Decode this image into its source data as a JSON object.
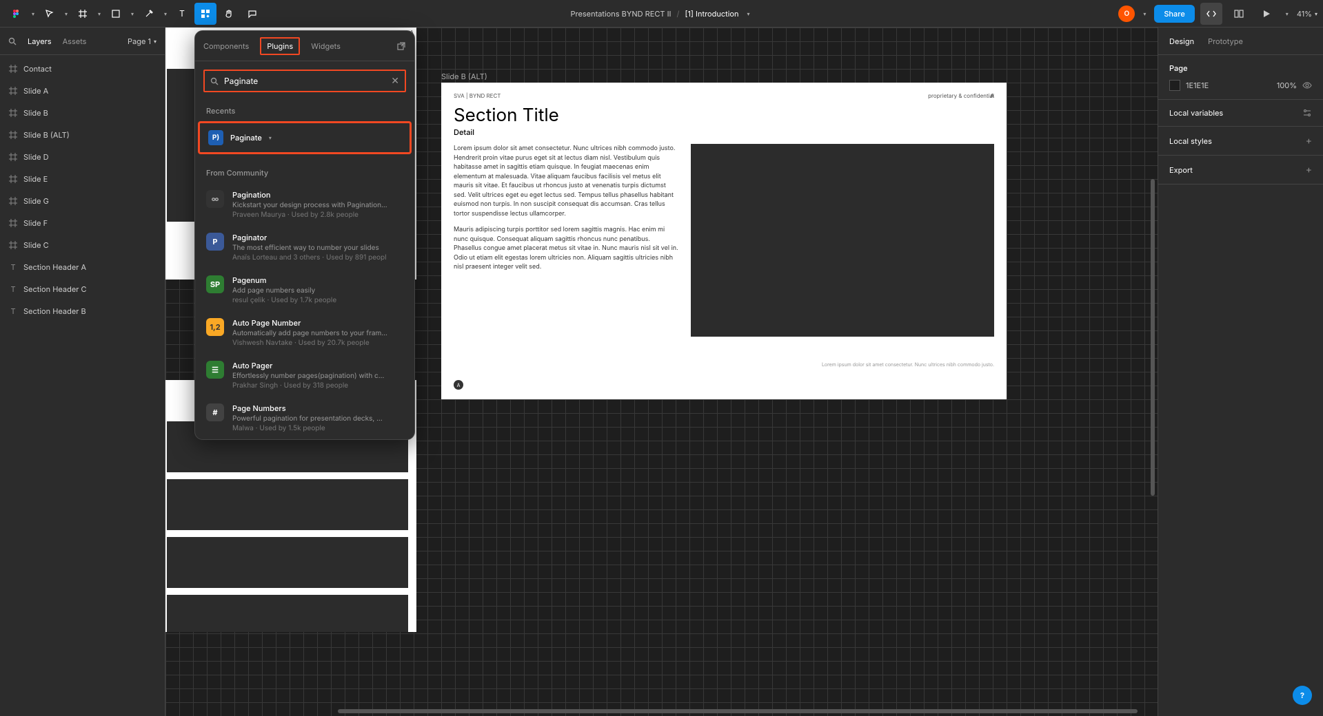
{
  "colors": {
    "accent": "#0c8ce9",
    "highlight": "#f24822",
    "bg": "#2c2c2c",
    "canvas": "#1e1e1e"
  },
  "toolbar": {
    "doc_crumb": "Presentations BYND RECT II",
    "doc_current": "[1] Introduction",
    "avatar_initial": "O",
    "share": "Share",
    "zoom": "41%"
  },
  "left": {
    "tab_layers": "Layers",
    "tab_assets": "Assets",
    "page_label": "Page 1",
    "layers": [
      {
        "icon": "frame",
        "name": "Contact"
      },
      {
        "icon": "frame",
        "name": "Slide A"
      },
      {
        "icon": "frame",
        "name": "Slide B"
      },
      {
        "icon": "frame",
        "name": "Slide B (ALT)"
      },
      {
        "icon": "frame",
        "name": "Slide D"
      },
      {
        "icon": "frame",
        "name": "Slide E"
      },
      {
        "icon": "frame",
        "name": "Slide G"
      },
      {
        "icon": "frame",
        "name": "Slide F"
      },
      {
        "icon": "frame",
        "name": "Slide C"
      },
      {
        "icon": "text",
        "name": "Section Header A"
      },
      {
        "icon": "text",
        "name": "Section Header C"
      },
      {
        "icon": "text",
        "name": "Section Header B"
      }
    ]
  },
  "canvas": {
    "frame_label": "Slide B (ALT)",
    "hd_left": "SVA | BYND RECT",
    "hd_right": "proprietary & confidential",
    "hd_a": "A",
    "title": "Section Title",
    "sub": "Detail",
    "p1": "Lorem ipsum dolor sit amet consectetur. Nunc ultrices nibh commodo justo. Hendrerit proin vitae purus eget sit at lectus diam nisl. Vestibulum quis habitasse amet in sagittis etiam quisque. In feugiat maecenas enim elementum at malesuada. Vitae aliquam faucibus facilisis vel metus elit mauris sit vitae. Et faucibus ut rhoncus justo at venenatis turpis dictumst sed. Velit ultrices eget eu eget lectus sed. Tempus tellus phasellus habitant euismod non turpis. In non suscipit consequat dis accumsan. Cras tellus tortor suspendisse lectus ullamcorper.",
    "p2": "Mauris adipiscing turpis porttitor sed lorem sagittis magnis. Hac enim mi nunc quisque. Consequat aliquam sagittis rhoncus nunc penatibus. Phasellus congue amet placerat metus sit vitae in. Nunc mauris nisl sit vel in. Odio ut etiam elit egestas lorem ultricies non. Aliquam sagittis ultricies nibh nisl praesent integer velit sed.",
    "fine": "Lorem ipsum dolor sit amet consectetur. Nunc ultrices nibh commodo justo.",
    "badge": "A",
    "ghost_txt": "commodo"
  },
  "right": {
    "tab_design": "Design",
    "tab_proto": "Prototype",
    "page_h": "Page",
    "page_color": "1E1E1E",
    "page_pct": "100%",
    "locals_h": "Local variables",
    "styles_h": "Local styles",
    "export_h": "Export"
  },
  "res": {
    "tab_components": "Components",
    "tab_plugins": "Plugins",
    "tab_widgets": "Widgets",
    "search_value": "Paginate",
    "recents_h": "Recents",
    "recent_name": "Paginate",
    "community_h": "From Community",
    "items": [
      {
        "icon": "∞",
        "cls": "ri-1",
        "title": "Pagination",
        "desc": "Kickstart your design process with Pagination...",
        "meta": "Praveen Maurya · Used by 2.8k people"
      },
      {
        "icon": "P",
        "cls": "ri-2",
        "title": "Paginator",
        "desc": "The most efficient way to number your slides",
        "meta": "Anaïs Lorteau and 3 others · Used by 891 peopl"
      },
      {
        "icon": "SP",
        "cls": "ri-3",
        "title": "Pagenum",
        "desc": "Add page numbers easily",
        "meta": "resul çelik · Used by 1.7k people"
      },
      {
        "icon": "1,2",
        "cls": "ri-4",
        "title": "Auto Page Number",
        "desc": "Automatically add page numbers to your fram...",
        "meta": "Vishwesh Navtake · Used by 20.7k people"
      },
      {
        "icon": "☰",
        "cls": "ri-5",
        "title": "Auto Pager",
        "desc": "Effortlessly number pages(pagination) with c...",
        "meta": "Prakhar Singh · Used by 318 people"
      },
      {
        "icon": "#",
        "cls": "ri-6",
        "title": "Page Numbers",
        "desc": "Powerful pagination for presentation decks, ...",
        "meta": "Malwa · Used by 1.5k people"
      }
    ]
  },
  "help": "?"
}
